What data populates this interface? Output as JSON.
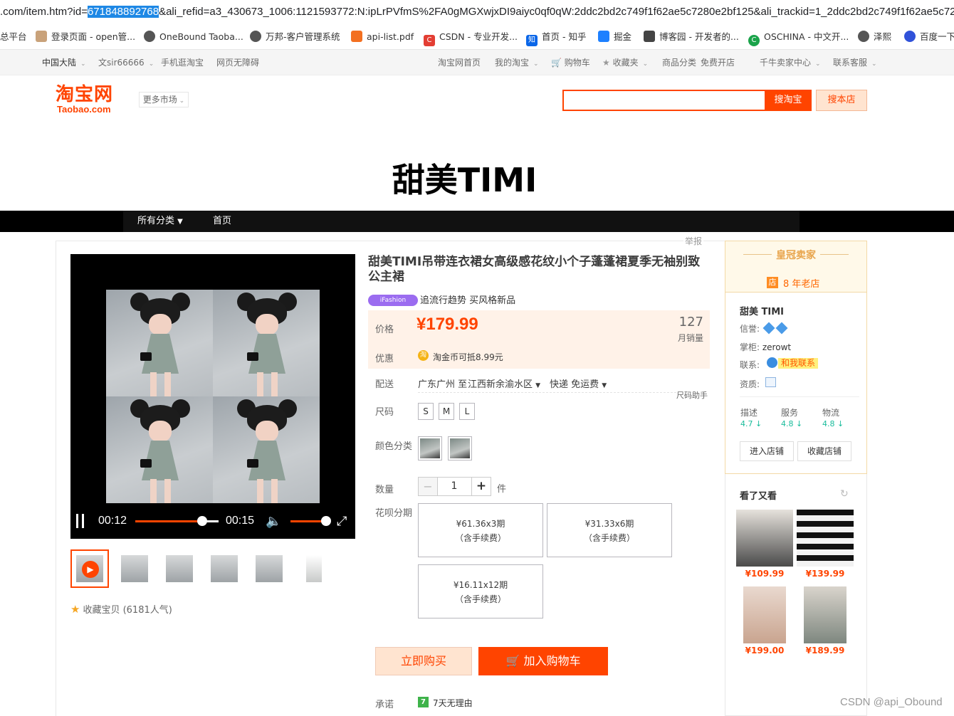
{
  "browser": {
    "url_prefix": ".com/item.htm?id=",
    "url_selected": "671848892768",
    "url_suffix": "&ali_refid=a3_430673_1006:1121593772:N:ipLrPVfmS%2FA0gMGXwjxDI9aiyc0qf0qW:2ddc2bd2c749f1f62ae5c7280e2bf125&ali_trackid=1_2ddc2bd2c749f1f62ae5c72",
    "bookmarks": [
      "总平台",
      "登录页面 - open管...",
      "OneBound Taoba...",
      "万邦-客户管理系统",
      "api-list.pdf",
      "CSDN - 专业开发...",
      "首页 - 知乎",
      "掘金",
      "博客园 - 开发者的...",
      "OSCHINA - 中文开...",
      "泽熙",
      "百度一下"
    ]
  },
  "site_nav": {
    "region": "中国大陆",
    "user": "文sir66666",
    "mobile": "手机逛淘宝",
    "accessibility": "网页无障碍",
    "home": "淘宝网首页",
    "my_taobao": "我的淘宝",
    "cart": "购物车",
    "favorites": "收藏夹",
    "categories": "商品分类",
    "open_shop": "免费开店",
    "seller_center": "千牛卖家中心",
    "service": "联系客服"
  },
  "header": {
    "logo_cn": "淘宝网",
    "logo_en": "Taobao.com",
    "more_market": "更多市场",
    "search_placeholder": "",
    "search_button": "搜淘宝",
    "search_shop_button": "搜本店"
  },
  "shop": {
    "title": "甜美TIMI",
    "nav": {
      "all_categories": "所有分类",
      "home": "首页"
    }
  },
  "product": {
    "report": "举报",
    "title": "甜美TIMI吊带连衣裙女高级感花纹小个子蓬蓬裙夏季无袖别致公主裙",
    "tag": "iFashion",
    "tag_text": "追流行趋势 买风格新品",
    "price_label": "价格",
    "price": "¥179.99",
    "sold": "127",
    "sold_label": "月销量",
    "promo_label": "优惠",
    "promo_text": "淘金币可抵8.99元",
    "delivery_label": "配送",
    "delivery_from": "广东广州 至",
    "delivery_to": "江西新余渝水区",
    "shipping": "快递 免运费",
    "size_helper": "尺码助手",
    "size_label": "尺码",
    "sizes": [
      "S",
      "M",
      "L"
    ],
    "color_label": "颜色分类",
    "qty_label": "数量",
    "qty_value": "1",
    "qty_unit": "件",
    "installment_label": "花呗分期",
    "installments": [
      {
        "amount": "¥61.36x3期",
        "fee": "（含手续费）"
      },
      {
        "amount": "¥31.33x6期",
        "fee": "（含手续费）"
      },
      {
        "amount": "¥16.11x12期",
        "fee": "（含手续费）"
      }
    ],
    "buy_now": "立即购买",
    "add_cart": "加入购物车",
    "promise_label": "承诺",
    "promise_icon": "7",
    "promise_text": "7天无理由",
    "favorite": "收藏宝贝 (6181人气)"
  },
  "video": {
    "current_time": "00:12",
    "total_time": "00:15",
    "progress": 0.8,
    "volume": 1.0
  },
  "seller": {
    "badge": "皇冠卖家",
    "old_shop_icon": "店",
    "old_shop": "8 年老店",
    "name": "甜美 TIMI",
    "credit_label": "信誉:",
    "owner_label": "掌柜:",
    "owner": "zerowt",
    "contact_label": "联系:",
    "contact_button": "和我联系",
    "qualification_label": "资质:",
    "scores": [
      {
        "label": "描述",
        "value": "4.7"
      },
      {
        "label": "服务",
        "value": "4.8"
      },
      {
        "label": "物流",
        "value": "4.8"
      }
    ],
    "enter_shop": "进入店铺",
    "favorite_shop": "收藏店铺"
  },
  "recommend": {
    "title": "看了又看",
    "items": [
      {
        "price": "¥109.99"
      },
      {
        "price": "¥139.99"
      },
      {
        "price": "¥199.00"
      },
      {
        "price": "¥189.99"
      }
    ]
  },
  "watermark": "CSDN @api_Obound",
  "colors": {
    "brand": "#ff4400",
    "seller_gold": "#e8a44b",
    "score_green": "#1abc9c"
  }
}
